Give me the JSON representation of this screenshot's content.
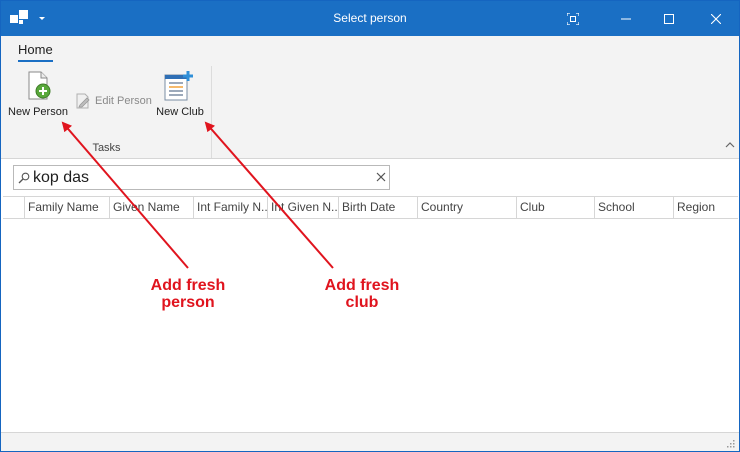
{
  "window": {
    "title": "Select person",
    "accent_color": "#1a6fc4",
    "controls": [
      "fullscreen-icon",
      "minimize-icon",
      "maximize-icon",
      "close-icon"
    ]
  },
  "ribbon": {
    "tabs": [
      {
        "label": "Home",
        "selected": true
      }
    ],
    "groups": [
      {
        "label": "Tasks",
        "buttons": [
          {
            "label": "New Person",
            "icon": "new-person-icon",
            "enabled": true
          },
          {
            "label": "Edit Person",
            "icon": "edit-icon",
            "enabled": false
          },
          {
            "label": "New Club",
            "icon": "new-club-icon",
            "enabled": true
          }
        ]
      }
    ]
  },
  "search": {
    "value": "kop das",
    "icon": "search-icon"
  },
  "grid": {
    "columns": [
      "Family Name",
      "Given Name",
      "Int Family N...",
      "Int Given N...",
      "Birth Date",
      "Country",
      "Club",
      "School",
      "Region"
    ],
    "rows": []
  },
  "annotations": [
    {
      "text_line1": "Add fresh",
      "text_line2": "person",
      "color": "#e0141e"
    },
    {
      "text_line1": "Add fresh",
      "text_line2": "club",
      "color": "#e0141e"
    }
  ]
}
